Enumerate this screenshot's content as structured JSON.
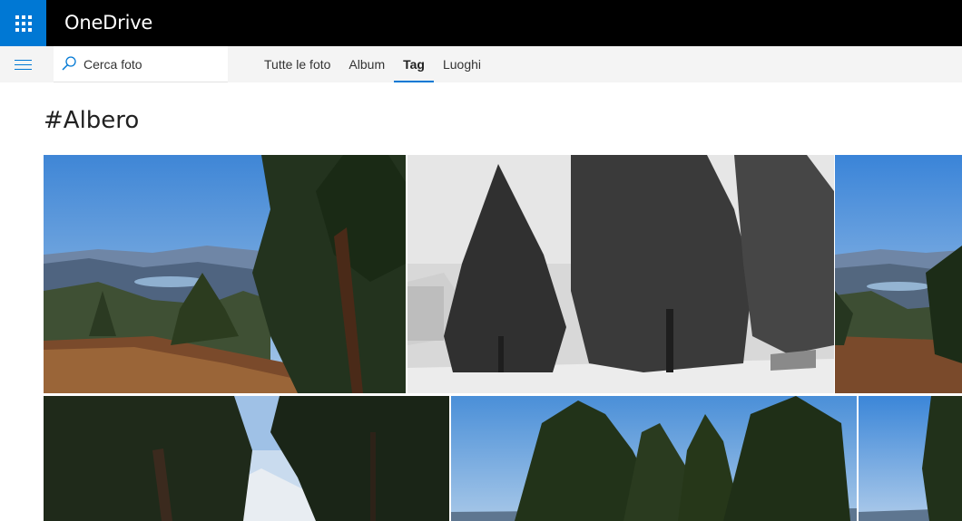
{
  "app": {
    "title": "OneDrive"
  },
  "search": {
    "placeholder": "Cerca foto"
  },
  "tabs": [
    {
      "label": "Tutte le foto",
      "active": false
    },
    {
      "label": "Album",
      "active": false
    },
    {
      "label": "Tag",
      "active": true
    },
    {
      "label": "Luoghi",
      "active": false
    }
  ],
  "page": {
    "title": "#Albero"
  },
  "icons": {
    "apps": "waffle-icon",
    "menu": "hamburger-icon",
    "search": "search-icon"
  },
  "colors": {
    "accent": "#0078d4",
    "topbar": "#000000",
    "navbar": "#f4f4f4"
  },
  "photos": [
    {
      "scene": "mountain-lake-pines",
      "palette": "color"
    },
    {
      "scene": "snowy-pines",
      "palette": "grayscale"
    },
    {
      "scene": "mountain-lake-partial",
      "palette": "color"
    },
    {
      "scene": "dark-pines-backlit",
      "palette": "color"
    },
    {
      "scene": "pines-blue-sky",
      "palette": "color"
    },
    {
      "scene": "pine-sky-partial",
      "palette": "color"
    }
  ]
}
